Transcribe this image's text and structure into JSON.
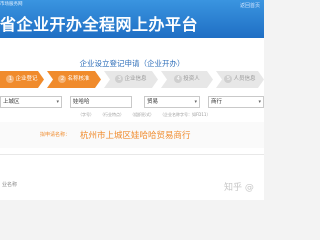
{
  "site_tag": "市场服务网",
  "banner_title": "省企业开办全程网上办平台",
  "top_link": "返回首页",
  "form_title": "企业设立登记申请（企业开办）",
  "steps": [
    {
      "num": "1",
      "label": "企业登记",
      "active": true
    },
    {
      "num": "2",
      "label": "名称核准",
      "active": true
    },
    {
      "num": "3",
      "label": "企业信息",
      "active": false
    },
    {
      "num": "4",
      "label": "投资人",
      "active": false
    },
    {
      "num": "5",
      "label": "人员信息",
      "active": false
    }
  ],
  "fields": [
    {
      "value": "上城区",
      "type": "select"
    },
    {
      "value": "娃哈哈",
      "type": "text"
    },
    {
      "value": "贸易",
      "type": "select"
    },
    {
      "value": "商行",
      "type": "select"
    }
  ],
  "hints": [
    "（字号）",
    "（行业特点）",
    "（组织形式）",
    "（企业名称字号：如FD11）"
  ],
  "preview": {
    "label": "拟申请名称：",
    "name": "杭州市上城区娃哈哈贸易商行"
  },
  "bottom_label": "业名称",
  "watermark": "知乎 @"
}
